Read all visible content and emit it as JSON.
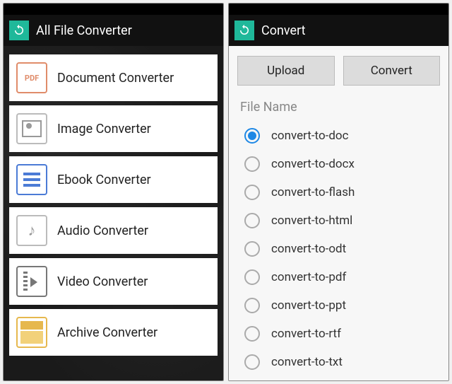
{
  "left": {
    "title": "All File Converter",
    "items": [
      {
        "label": "Document Converter",
        "icon": "pdf"
      },
      {
        "label": "Image Converter",
        "icon": "image"
      },
      {
        "label": "Ebook Converter",
        "icon": "ebook"
      },
      {
        "label": "Audio Converter",
        "icon": "audio"
      },
      {
        "label": "Video Converter",
        "icon": "video"
      },
      {
        "label": "Archive Converter",
        "icon": "archive"
      }
    ]
  },
  "right": {
    "title": "Convert",
    "buttons": {
      "upload": "Upload",
      "convert": "Convert"
    },
    "section_label": "File Name",
    "options": [
      {
        "label": "convert-to-doc",
        "selected": true
      },
      {
        "label": "convert-to-docx",
        "selected": false
      },
      {
        "label": "convert-to-flash",
        "selected": false
      },
      {
        "label": "convert-to-html",
        "selected": false
      },
      {
        "label": "convert-to-odt",
        "selected": false
      },
      {
        "label": "convert-to-pdf",
        "selected": false
      },
      {
        "label": "convert-to-ppt",
        "selected": false
      },
      {
        "label": "convert-to-rtf",
        "selected": false
      },
      {
        "label": "convert-to-txt",
        "selected": false
      }
    ]
  }
}
